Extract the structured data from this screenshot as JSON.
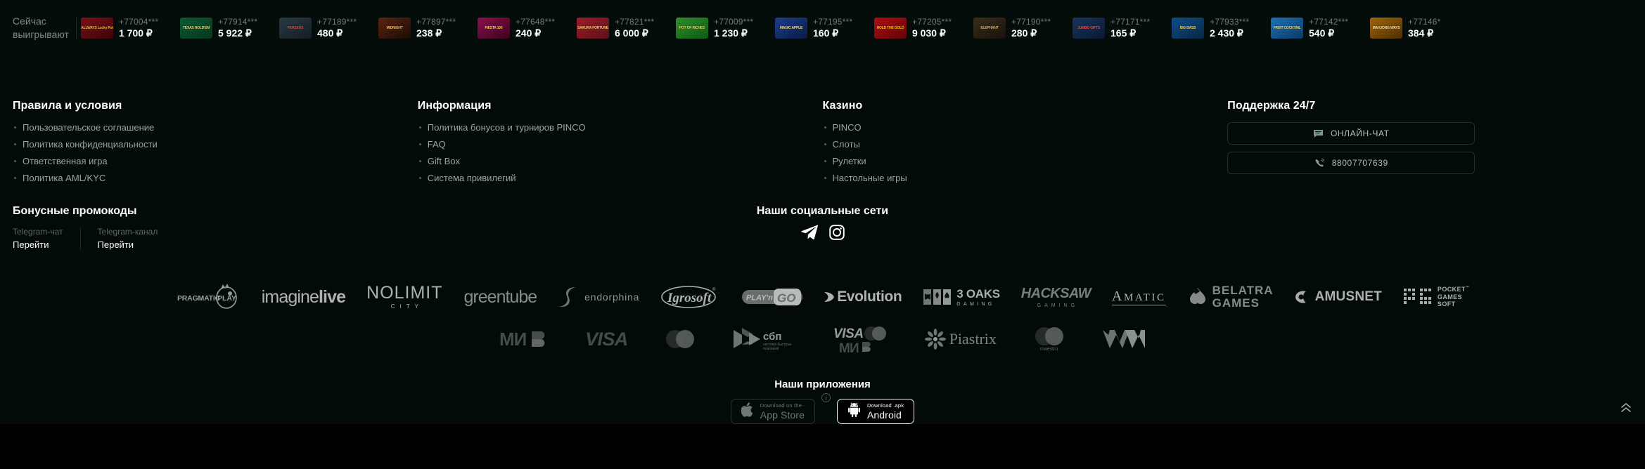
{
  "ticker": {
    "label": "Сейчас\nвыигрывают",
    "label_line1": "Сейчас",
    "label_line2": "выигрывают",
    "winners": [
      {
        "phone": "+77004***",
        "amount": "1 700 ₽",
        "game": "ALLWAYS Lucky Pot",
        "bg1": "#7a1018",
        "bg2": "#3c0408",
        "fg": "#f4c038"
      },
      {
        "phone": "+77914***",
        "amount": "5 922 ₽",
        "game": "TEXAS HOLD'EM",
        "bg1": "#0e5a32",
        "bg2": "#06361e",
        "fg": "#ffd65a"
      },
      {
        "phone": "+77189***",
        "amount": "480 ₽",
        "game": "PERSEUS",
        "bg1": "#2a3b46",
        "bg2": "#131c23",
        "fg": "#e24a3a"
      },
      {
        "phone": "+77897***",
        "amount": "238 ₽",
        "game": "MIDNIGHT",
        "bg1": "#5a2411",
        "bg2": "#1c0b05",
        "fg": "#ffbb55"
      },
      {
        "phone": "+77648***",
        "amount": "240 ₽",
        "game": "FIESTA 100",
        "bg1": "#8c0f4c",
        "bg2": "#3c0320",
        "fg": "#ffd23f"
      },
      {
        "phone": "+77821***",
        "amount": "6 000 ₽",
        "game": "SAKURA FORTUNE",
        "bg1": "#9c1f2a",
        "bg2": "#5d0f16",
        "fg": "#ffcf5c"
      },
      {
        "phone": "+77009***",
        "amount": "1 230 ₽",
        "game": "POT OF RICHES",
        "bg1": "#2e8f2a",
        "bg2": "#0f5a16",
        "fg": "#ffd84a"
      },
      {
        "phone": "+77195***",
        "amount": "160 ₽",
        "game": "MAGIC APPLE",
        "bg1": "#1b3f8c",
        "bg2": "#0a1a45",
        "fg": "#ffe066"
      },
      {
        "phone": "+77205***",
        "amount": "9 030 ₽",
        "game": "HOLD THE GOLD",
        "bg1": "#b10d12",
        "bg2": "#610408",
        "fg": "#ffd000"
      },
      {
        "phone": "+77190***",
        "amount": "280 ₽",
        "game": "ELEPHANT",
        "bg1": "#3a2f1d",
        "bg2": "#16110a",
        "fg": "#d8b66a"
      },
      {
        "phone": "+77171***",
        "amount": "165 ₽",
        "game": "JUMBO GIFTS",
        "bg1": "#19365e",
        "bg2": "#0a1730",
        "fg": "#ff4a4a"
      },
      {
        "phone": "+77933***",
        "amount": "2 430 ₽",
        "game": "BIG BASS",
        "bg1": "#0f4f8a",
        "bg2": "#062642",
        "fg": "#ffd84a"
      },
      {
        "phone": "+77142***",
        "amount": "540 ₽",
        "game": "FRUIT COCKTAIL",
        "bg1": "#1c72b8",
        "bg2": "#0a3a66",
        "fg": "#ffe066"
      },
      {
        "phone": "+77146*",
        "amount": "384 ₽",
        "game": "MAHJONG WAYS",
        "bg1": "#a0670c",
        "bg2": "#4e2e02",
        "fg": "#ffe8a0"
      }
    ]
  },
  "footer": {
    "columns": [
      {
        "title": "Правила и условия",
        "items": [
          "Пользовательское соглашение",
          "Политика конфиденциальности",
          "Ответственная игра",
          "Политика AML/KYC"
        ]
      },
      {
        "title": "Информация",
        "items": [
          "Политика бонусов и турниров PINCO",
          "FAQ",
          "Gift Box",
          "Система привилегий"
        ]
      },
      {
        "title": "Казино",
        "items": [
          "PINCO",
          "Слоты",
          "Рулетки",
          "Настольные игры"
        ]
      }
    ],
    "support": {
      "title": "Поддержка 24/7",
      "chat_label": "ОНЛАЙН-ЧАТ",
      "phone_label": "88007707639"
    },
    "promo": {
      "title": "Бонусные промокоды",
      "links": [
        {
          "caption": "Telegram-чат",
          "action": "Перейти"
        },
        {
          "caption": "Telegram-канал",
          "action": "Перейти"
        }
      ]
    },
    "social": {
      "title": "Наши социальные сети",
      "items": [
        {
          "name": "telegram",
          "label": "Telegram"
        },
        {
          "name": "instagram",
          "label": "Instagram"
        }
      ]
    },
    "providers": [
      "PRAGMATIC PLAY",
      "imaginelive",
      "NOLIMIT CITY",
      "greentube",
      "endorphina",
      "Igrosoft",
      "PLAY'n GO",
      "Evolution",
      "3 OAKS GAMING",
      "HACKSAW GAMING",
      "AMATIC",
      "BELATRA GAMES",
      "AMUSNET",
      "PG POCKET GAMES SOFT"
    ],
    "payments": [
      "МИР",
      "VISA",
      "Mastercard",
      "СБП система быстрых платежей",
      "VISA МИР Mastercard",
      "Piastrix",
      "maestro",
      "WW"
    ],
    "apps": {
      "title": "Наши приложения",
      "ios": {
        "small": "Download on the",
        "big": "App Store"
      },
      "android": {
        "small": "Download .apk",
        "big": "Android"
      }
    }
  },
  "colors": {
    "bg": "#030b09",
    "ticker_bg": "#050d0b",
    "accent": "#a9c2bd",
    "muted": "#9aa5a3"
  }
}
